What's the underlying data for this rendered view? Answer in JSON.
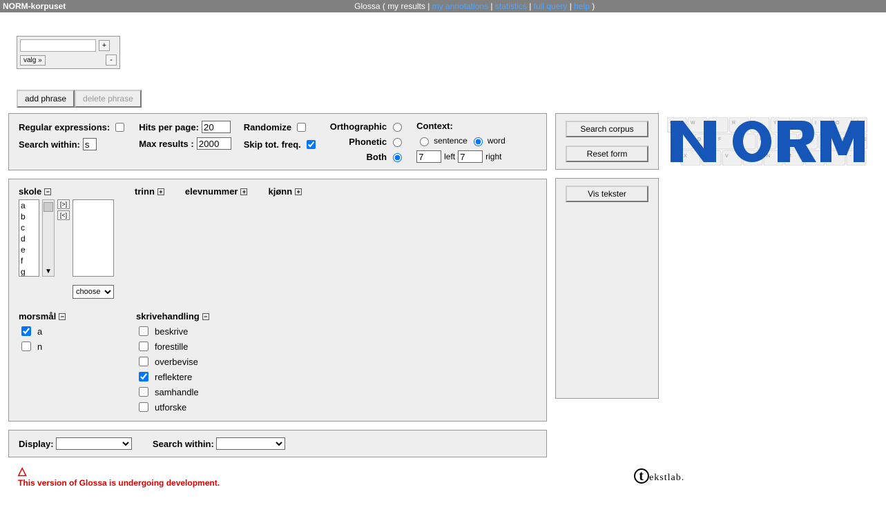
{
  "topbar": {
    "title": "NORM-korpuset",
    "app": "Glossa",
    "links": {
      "my_results": "my results",
      "my_annotations": "my annotations",
      "statistics": "statistics",
      "full_query": "full query",
      "help": "help"
    }
  },
  "phrase_box": {
    "input_value": "",
    "valg_label": "valg »",
    "plus": "+",
    "minus": "-"
  },
  "phrase_buttons": {
    "add": "add phrase",
    "delete": "delete phrase"
  },
  "search_options": {
    "regex_label": "Regular expressions:",
    "regex_checked": false,
    "search_within_label": "Search within:",
    "search_within_value": "s",
    "hits_label": "Hits per page:",
    "hits_value": "20",
    "max_label": "Max results :",
    "max_value": "2000",
    "randomize_label": "Randomize",
    "randomize_checked": false,
    "skip_label": "Skip tot. freq.",
    "skip_checked": true,
    "ortho_label": "Orthographic",
    "phonetic_label": "Phonetic",
    "both_label": "Both",
    "view_selected": "both",
    "context_label": "Context:",
    "sentence_label": "sentence",
    "word_label": "word",
    "context_selected": "word",
    "left_val": "7",
    "left_label": "left",
    "right_val": "7",
    "right_label": "right"
  },
  "buttons": {
    "search": "Search corpus",
    "reset": "Reset form",
    "vis": "Vis tekster"
  },
  "filters": {
    "skole": {
      "label": "skole",
      "toggle": "−",
      "options": [
        "a",
        "b",
        "c",
        "d",
        "e",
        "f",
        "g"
      ],
      "choose_label": "choose"
    },
    "trinn": {
      "label": "trinn",
      "toggle": "+"
    },
    "elevnummer": {
      "label": "elevnummer",
      "toggle": "+"
    },
    "kjonn": {
      "label": "kjønn",
      "toggle": "+"
    },
    "morsmal": {
      "label": "morsmål",
      "toggle": "−",
      "items": [
        {
          "label": "a",
          "checked": true
        },
        {
          "label": "n",
          "checked": false
        }
      ]
    },
    "skrivehandling": {
      "label": "skrivehandling",
      "toggle": "−",
      "items": [
        {
          "label": "beskrive",
          "checked": false
        },
        {
          "label": "forestille",
          "checked": false
        },
        {
          "label": "overbevise",
          "checked": false
        },
        {
          "label": "reflektere",
          "checked": true
        },
        {
          "label": "samhandle",
          "checked": false
        },
        {
          "label": "utforske",
          "checked": false
        }
      ]
    }
  },
  "display": {
    "display_label": "Display:",
    "search_within_label": "Search within:"
  },
  "footer": {
    "warning_icon": "△",
    "warning": "This version of Glossa is undergoing development.",
    "tekstlab": "ekstlab."
  }
}
